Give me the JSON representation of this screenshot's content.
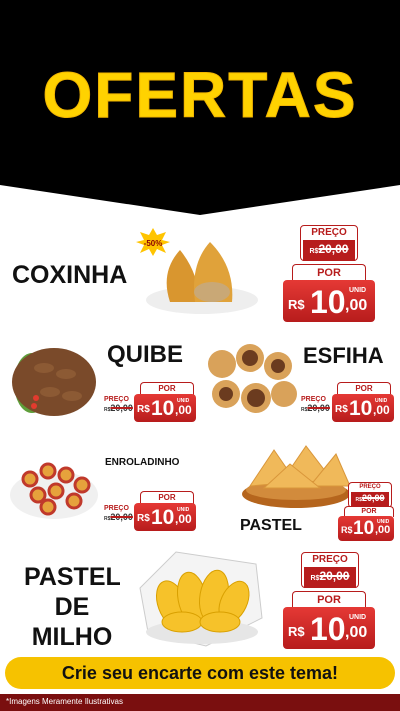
{
  "header": {
    "title": "OFERTAS"
  },
  "badge": {
    "discount": "-50%"
  },
  "products": {
    "coxinha": {
      "name": "COXINHA",
      "price_label": "PREÇO",
      "old_price": "20,00",
      "por_label": "POR",
      "currency": "R$",
      "price_int": "10",
      "price_cents": ",00",
      "unit": "UNID"
    },
    "quibe": {
      "name": "QUIBE",
      "price_label": "PREÇO",
      "old_price": "20,00",
      "currency_old": "R$",
      "por_label": "POR",
      "currency": "R$",
      "price_int": "10",
      "price_cents": ",00",
      "unit": "UNID"
    },
    "esfiha": {
      "name": "ESFIHA",
      "price_label": "PREÇO",
      "old_price": "20,00",
      "currency_old": "R$",
      "por_label": "POR",
      "currency": "R$",
      "price_int": "10",
      "price_cents": ",00",
      "unit": "UNID"
    },
    "enroladinho": {
      "name": "ENROLADINHO",
      "price_label": "PREÇO",
      "old_price": "20,00",
      "currency_old": "R$",
      "por_label": "POR",
      "currency": "R$",
      "price_int": "10",
      "price_cents": ",00",
      "unit": "UNID"
    },
    "pastel": {
      "name": "PASTEL",
      "price_label": "PREÇO",
      "old_price": "20,00",
      "currency_old": "R$",
      "por_label": "POR",
      "currency": "R$",
      "price_int": "10",
      "price_cents": ",00",
      "unit": "UNID"
    },
    "pastel_milho": {
      "name_line1": "PASTEL",
      "name_line2": "DE",
      "name_line3": "MILHO",
      "price_label": "PREÇO",
      "old_price": "20,00",
      "por_label": "POR",
      "currency": "R$",
      "price_int": "10",
      "price_cents": ",00",
      "unit": "UNID"
    }
  },
  "cta": {
    "text": "Crie seu encarte com este tema!"
  },
  "footnote": {
    "text": "*Imagens Meramente Ilustrativas"
  },
  "colors": {
    "header_bg": "#000000",
    "title": "#ffd200",
    "price_red": "#c62828",
    "cta_bg": "#f6c200",
    "footer_bar": "#7a0f0f"
  }
}
